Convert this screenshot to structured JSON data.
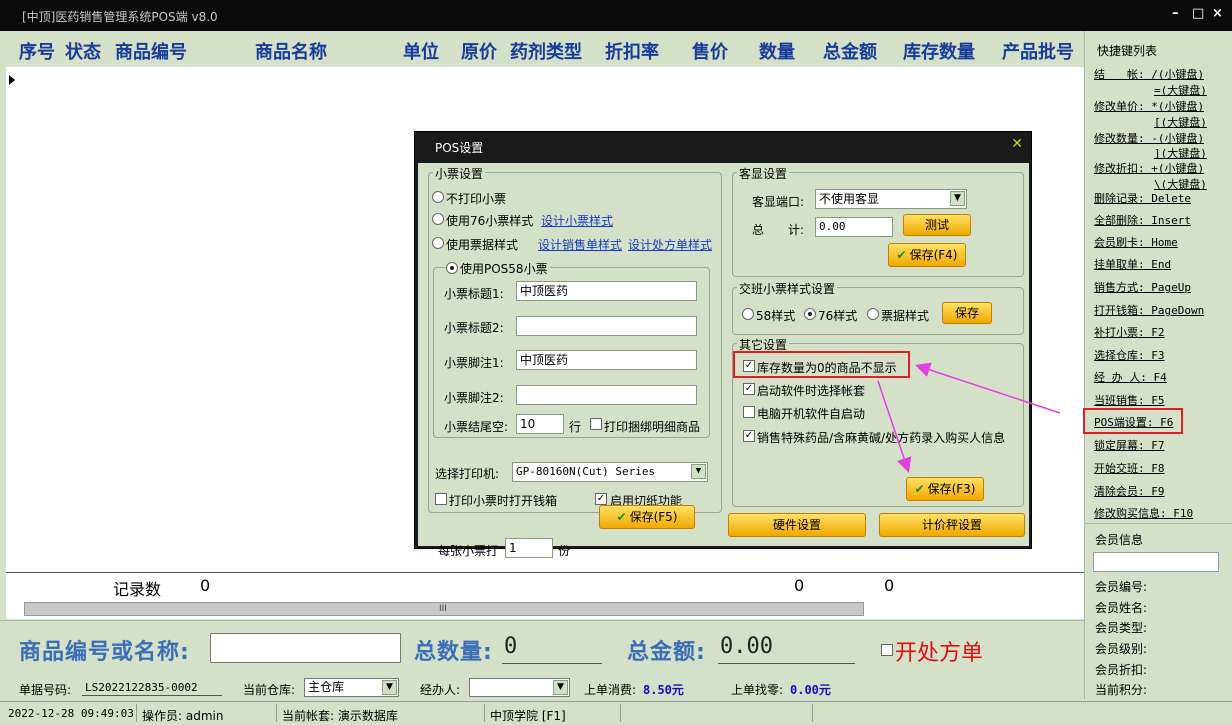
{
  "window": {
    "title": "[中顶]医药销售管理系统POS端 v8.0",
    "min": "–",
    "max": "□",
    "close": "×"
  },
  "grid": {
    "columns": [
      "序号",
      "状态",
      "商品编号",
      "商品名称",
      "单位",
      "原价",
      "药剂类型",
      "折扣率",
      "售价",
      "数量",
      "总金额",
      "库存数量",
      "产品批号"
    ],
    "footer": {
      "record_label": "记录数",
      "record_count": "0",
      "qty_total": "0",
      "amount_total": "0"
    },
    "scroll_thumb": "III"
  },
  "shortcuts": {
    "title": "快捷键列表",
    "items": [
      "结　　帐: /(小键盘)",
      "=(大键盘)",
      "修改单价: *(小键盘)",
      "[(大键盘)",
      "修改数量: -(小键盘)",
      "](大键盘)",
      "修改折扣: +(小键盘)",
      "\\(大键盘)",
      "删除记录: Delete",
      "全部删除: Insert",
      "会员刷卡: Home",
      "挂单取单: End",
      "销售方式: PageUp",
      "打开钱箱: PageDown",
      "补打小票: F2",
      "选择仓库: F3",
      "经 办 人: F4",
      "当班销售: F5",
      "POS端设置: F6",
      "锁定屏幕: F7",
      "开始交班: F8",
      "清除会员: F9",
      "修改购买信息: F10"
    ]
  },
  "member": {
    "title": "会员信息",
    "fields": [
      "会员编号:",
      "会员姓名:",
      "会员类型:",
      "会员级别:",
      "会员折扣:",
      "当前积分:"
    ]
  },
  "bottom": {
    "code_label": "商品编号或名称:",
    "qty_label": "总数量:",
    "qty_value": "0",
    "amount_label": "总金额:",
    "amount_value": "0.00",
    "prescription_label": "开处方单"
  },
  "info": {
    "order_label": "单据号码:",
    "order_value": "LS2022122835-0002",
    "warehouse_label": "当前仓库:",
    "warehouse_value": "主仓库",
    "handler_label": "经办人:",
    "handler_value": "",
    "last_spend_label": "上单消费:",
    "last_spend_value": "8.50元",
    "last_change_label": "上单找零:",
    "last_change_value": "0.00元"
  },
  "status": {
    "datetime": "2022-12-28 09:49:03",
    "operator": "操作员: admin",
    "account": "当前帐套: 演示数据库",
    "college": "中顶学院 [F1]"
  },
  "dialog": {
    "title": "POS设置",
    "receipt": {
      "title": "小票设置",
      "opt_none": "不打印小票",
      "opt_76": "使用76小票样式",
      "link_design": "设计小票样式",
      "opt_bill": "使用票据样式",
      "link_sales": "设计销售单样式",
      "link_rx": "设计处方单样式",
      "pos58_title": "使用POS58小票",
      "title1_label": "小票标题1:",
      "title1_value": "中顶医药",
      "title2_label": "小票标题2:",
      "title2_value": "",
      "foot1_label": "小票脚注1:",
      "foot1_value": "中顶医药",
      "foot2_label": "小票脚注2:",
      "foot2_value": "",
      "tail_label": "小票结尾空:",
      "tail_value": "10",
      "tail_unit": "行",
      "bundle_label": "打印捆绑明细商品"
    },
    "printer": {
      "label": "选择打印机:",
      "value": "GP-80160N(Cut) Series",
      "open_drawer": "打印小票时打开钱箱",
      "cutter": "启用切纸功能",
      "copies_label": "每张小票打",
      "copies_value": "1",
      "copies_unit": "份",
      "save": "保存(F5)"
    },
    "display": {
      "title": "客显设置",
      "port_label": "客显端口:",
      "port_value": "不使用客显",
      "total_label": "总　　计:",
      "total_value": "0.00",
      "test": "测试",
      "save": "保存(F4)"
    },
    "shift": {
      "title": "交班小票样式设置",
      "opt58": "58样式",
      "opt76": "76样式",
      "optbill": "票据样式",
      "save": "保存"
    },
    "other": {
      "title": "其它设置",
      "opt1": "库存数量为0的商品不显示",
      "opt2": "启动软件时选择帐套",
      "opt3": "电脑开机软件自启动",
      "opt4": "销售特殊药品/含麻黄碱/处方药录入购买人信息",
      "save": "保存(F3)"
    },
    "hardware_btn": "硬件设置",
    "scale_btn": "计价秤设置"
  },
  "colors": {
    "accent_text": "#1a3c9a",
    "annotation": "#e040e0",
    "highlight": "#e02020"
  }
}
